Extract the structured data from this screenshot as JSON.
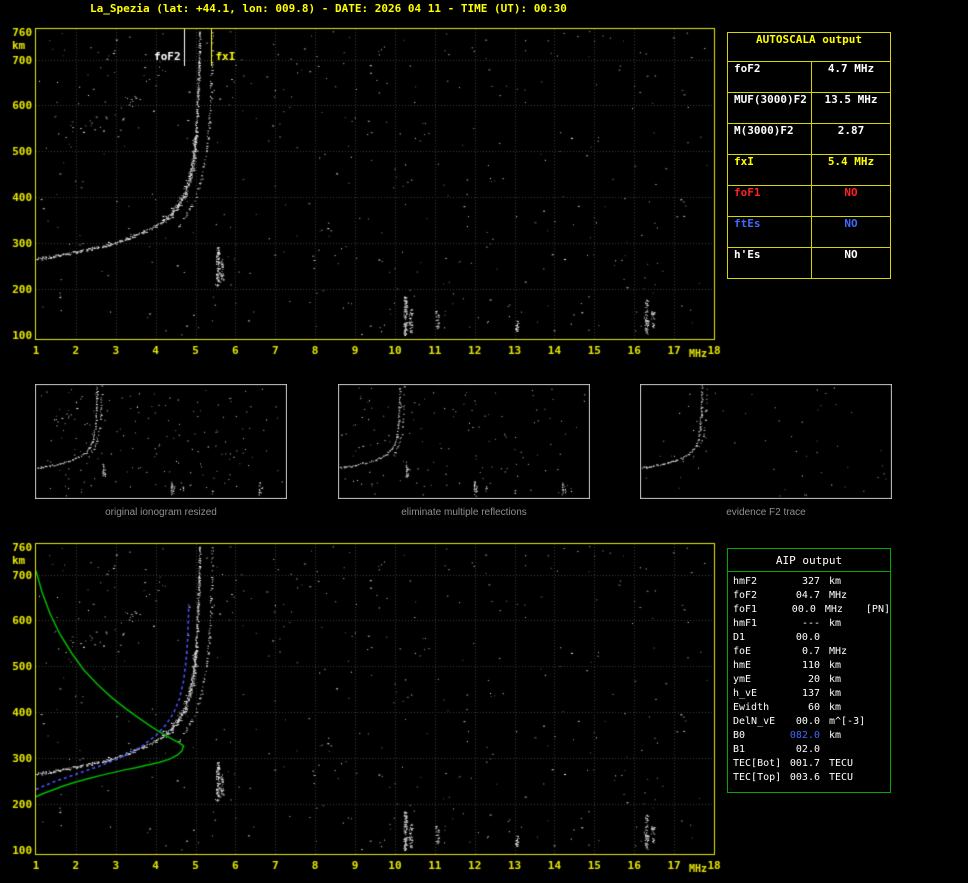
{
  "window": {
    "title": "La_Spezia (lat: +44.1, lon: 009.8) - DATE: 2026 04 11 - TIME (UT): 00:30"
  },
  "colors": {
    "background": "#000000",
    "axis": "#e8e800",
    "grid": "#3a3a3a",
    "trace": "#ffffff",
    "profile_green": "#00bb00",
    "restored_blue": "#4455ff",
    "thumb_border": "#c8c8c8",
    "caption_gray": "#8f8f8f",
    "autoscala_border": "#d6d600",
    "aip_border": "#00aa00",
    "status_red": "#ff2222",
    "status_blue": "#4466ff",
    "status_yellow": "#ffff00"
  },
  "chart_data": [
    {
      "type": "scatter",
      "name": "autoscaled ionogram (virtual height vs frequency)",
      "xlabel": "MHz",
      "ylabel": "km",
      "x_range": [
        1,
        18
      ],
      "y_range": [
        100,
        760
      ],
      "x_ticks": [
        1,
        2,
        3,
        4,
        5,
        6,
        7,
        8,
        9,
        10,
        11,
        12,
        13,
        14,
        15,
        16,
        17,
        18
      ],
      "y_ticks": [
        760,
        700,
        600,
        500,
        400,
        300,
        200,
        100
      ],
      "grid": true,
      "noise_seed": 13,
      "noise_count": 430,
      "trace_o": [
        [
          1.0,
          266
        ],
        [
          1.3,
          270
        ],
        [
          1.6,
          274
        ],
        [
          2.0,
          281
        ],
        [
          2.4,
          289
        ],
        [
          2.8,
          297
        ],
        [
          3.1,
          305
        ],
        [
          3.4,
          314
        ],
        [
          3.7,
          325
        ],
        [
          4.0,
          338
        ],
        [
          4.2,
          350
        ],
        [
          4.4,
          366
        ],
        [
          4.55,
          383
        ],
        [
          4.7,
          404
        ],
        [
          4.8,
          427
        ],
        [
          4.88,
          455
        ],
        [
          4.94,
          490
        ],
        [
          4.99,
          530
        ],
        [
          5.03,
          578
        ],
        [
          5.06,
          630
        ],
        [
          5.08,
          690
        ],
        [
          5.1,
          760
        ]
      ],
      "trace_x": [
        [
          4.55,
          335
        ],
        [
          4.75,
          360
        ],
        [
          4.95,
          392
        ],
        [
          5.1,
          428
        ],
        [
          5.2,
          468
        ],
        [
          5.28,
          512
        ],
        [
          5.33,
          560
        ],
        [
          5.37,
          618
        ],
        [
          5.4,
          678
        ],
        [
          5.42,
          760
        ]
      ],
      "trace_second_hop": [
        [
          1.5,
          538
        ],
        [
          1.9,
          546
        ],
        [
          2.3,
          556
        ],
        [
          2.7,
          570
        ],
        [
          3.0,
          585
        ],
        [
          3.3,
          603
        ],
        [
          3.6,
          626
        ],
        [
          3.8,
          650
        ],
        [
          3.95,
          676
        ],
        [
          4.1,
          705
        ]
      ],
      "interference_strips": [
        {
          "f": 5.55,
          "h_min": 205,
          "h_max": 292,
          "n": 80
        },
        {
          "f": 5.65,
          "h_min": 215,
          "h_max": 265,
          "n": 30
        },
        {
          "f": 10.25,
          "h_min": 100,
          "h_max": 185,
          "n": 90
        },
        {
          "f": 10.38,
          "h_min": 105,
          "h_max": 160,
          "n": 35
        },
        {
          "f": 11.05,
          "h_min": 112,
          "h_max": 155,
          "n": 22
        },
        {
          "f": 13.05,
          "h_min": 102,
          "h_max": 132,
          "n": 14
        },
        {
          "f": 16.3,
          "h_min": 102,
          "h_max": 178,
          "n": 55
        },
        {
          "f": 16.45,
          "h_min": 115,
          "h_max": 155,
          "n": 18
        }
      ],
      "markers": [
        {
          "label": "foF2",
          "f": 4.7,
          "color": "#ffffff",
          "label_side": "left"
        },
        {
          "label": "fxI",
          "f": 5.4,
          "color": "#ffff00",
          "label_side": "right"
        }
      ]
    },
    {
      "type": "scatter",
      "name": "ionogram with AIP electron density profile and restored trace",
      "uses_traces_of": 0,
      "xlabel": "MHz",
      "ylabel": "km",
      "x_range": [
        1,
        18
      ],
      "y_range": [
        100,
        760
      ],
      "profile": {
        "color": "#00bb00",
        "points": [
          [
            1.0,
            708
          ],
          [
            1.15,
            662
          ],
          [
            1.35,
            615
          ],
          [
            1.6,
            570
          ],
          [
            1.9,
            528
          ],
          [
            2.2,
            492
          ],
          [
            2.55,
            460
          ],
          [
            2.9,
            432
          ],
          [
            3.25,
            408
          ],
          [
            3.6,
            386
          ],
          [
            3.9,
            368
          ],
          [
            4.2,
            352
          ],
          [
            4.45,
            340
          ],
          [
            4.6,
            333
          ],
          [
            4.7,
            327
          ],
          [
            4.66,
            316
          ],
          [
            4.55,
            307
          ],
          [
            4.35,
            298
          ],
          [
            4.1,
            291
          ],
          [
            3.8,
            285
          ],
          [
            3.5,
            279
          ],
          [
            3.2,
            274
          ],
          [
            2.9,
            268
          ],
          [
            2.6,
            262
          ],
          [
            2.3,
            255
          ],
          [
            2.0,
            248
          ],
          [
            1.7,
            240
          ],
          [
            1.4,
            230
          ],
          [
            1.15,
            222
          ],
          [
            1.0,
            216
          ]
        ]
      },
      "restored_trace": {
        "color": "#4455ff",
        "dash": [
          3,
          3
        ],
        "points": [
          [
            1.0,
            232
          ],
          [
            1.4,
            247
          ],
          [
            1.8,
            259
          ],
          [
            2.2,
            271
          ],
          [
            2.6,
            283
          ],
          [
            3.0,
            297
          ],
          [
            3.4,
            313
          ],
          [
            3.7,
            329
          ],
          [
            4.0,
            349
          ],
          [
            4.25,
            372
          ],
          [
            4.45,
            398
          ],
          [
            4.6,
            430
          ],
          [
            4.7,
            468
          ],
          [
            4.76,
            510
          ],
          [
            4.8,
            555
          ],
          [
            4.82,
            600
          ],
          [
            4.83,
            635
          ]
        ]
      }
    }
  ],
  "thumbnails": [
    {
      "caption": "original ionogram resized",
      "noise_seed": 21,
      "noise_count": 170,
      "show_second_hop": true,
      "show_strips": true
    },
    {
      "caption": "eliminate multiple reflections",
      "noise_seed": 22,
      "noise_count": 140,
      "show_second_hop": false,
      "show_strips": true
    },
    {
      "caption": "evidence F2 trace",
      "noise_seed": 23,
      "noise_count": 55,
      "show_second_hop": false,
      "show_strips": false
    }
  ],
  "autoscala": {
    "title": "AUTOSCALA output",
    "rows": [
      {
        "label": "foF2",
        "value": "4.7 MHz",
        "color": "#ffffff"
      },
      {
        "label": "MUF(3000)F2",
        "value": "13.5 MHz",
        "color": "#ffffff"
      },
      {
        "label": "M(3000)F2",
        "value": "2.87",
        "color": "#ffffff"
      },
      {
        "label": "fxI",
        "value": "5.4 MHz",
        "color": "#ffff00"
      },
      {
        "label": "foF1",
        "value": "NO",
        "color": "#ff2222"
      },
      {
        "label": "ftEs",
        "value": "NO",
        "color": "#4466ff"
      },
      {
        "label": "h'Es",
        "value": "NO",
        "color": "#ffffff"
      }
    ]
  },
  "aip": {
    "title": "AIP output",
    "rows": [
      {
        "label": "hmF2",
        "value": "327",
        "unit": "km",
        "note": ""
      },
      {
        "label": "foF2",
        "value": "04.7",
        "unit": "MHz",
        "note": ""
      },
      {
        "label": "foF1",
        "value": "00.0",
        "unit": "MHz",
        "note": "[PN]"
      },
      {
        "label": "hmF1",
        "value": "---",
        "unit": "km",
        "note": ""
      },
      {
        "label": "D1",
        "value": "00.0",
        "unit": "",
        "note": ""
      },
      {
        "label": "foE",
        "value": "0.7",
        "unit": "MHz",
        "note": ""
      },
      {
        "label": "hmE",
        "value": "110",
        "unit": "km",
        "note": ""
      },
      {
        "label": "ymE",
        "value": "20",
        "unit": "km",
        "note": ""
      },
      {
        "label": "h_vE",
        "value": "137",
        "unit": "km",
        "note": ""
      },
      {
        "label": "Ewidth",
        "value": "60",
        "unit": "km",
        "note": ""
      },
      {
        "label": "DelN_vE",
        "value": "00.0",
        "unit": "m^[-3]",
        "note": ""
      },
      {
        "label": "B0",
        "value": "082.0",
        "unit": "km",
        "note": ""
      },
      {
        "label": "B1",
        "value": "02.0",
        "unit": "",
        "note": ""
      },
      {
        "label": "TEC[Bot]",
        "value": "001.7",
        "unit": "TECU",
        "note": ""
      },
      {
        "label": "TEC[Top]",
        "value": "003.6",
        "unit": "TECU",
        "note": ""
      }
    ]
  }
}
